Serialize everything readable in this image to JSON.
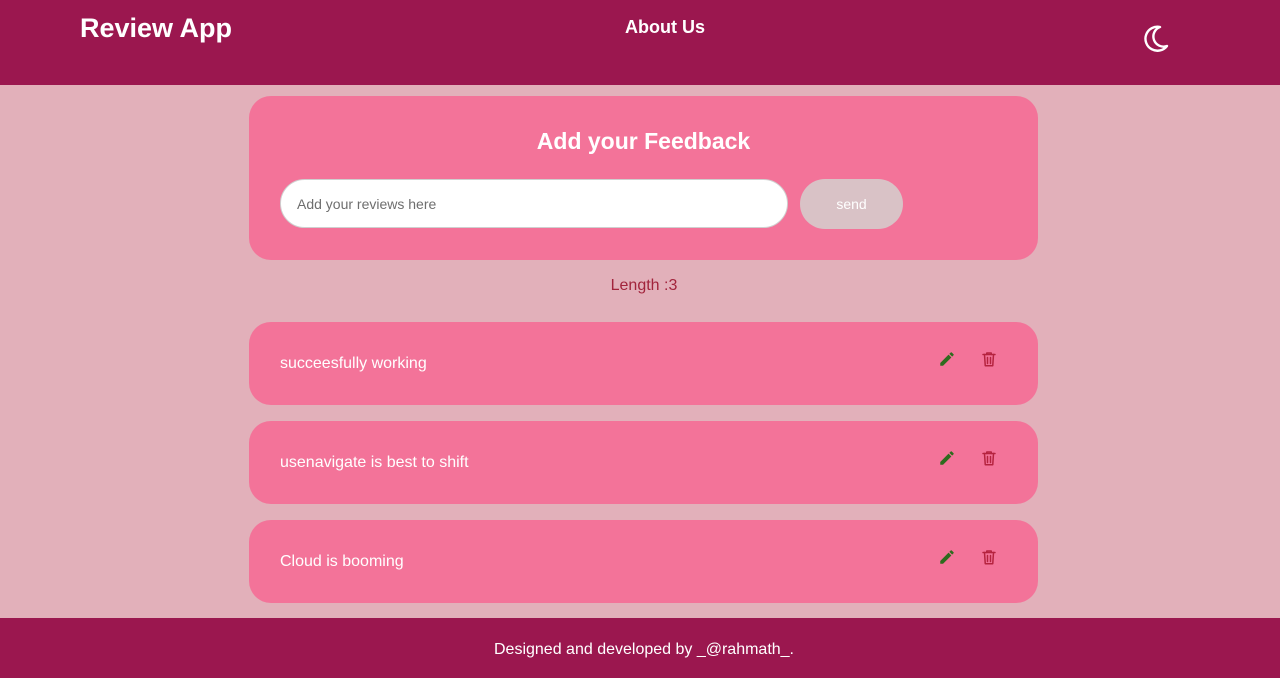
{
  "header": {
    "brand": "Review App",
    "nav_about": "About Us",
    "theme_icon": "moon-icon"
  },
  "form": {
    "title": "Add your Feedback",
    "input_placeholder": "Add your reviews here",
    "input_value": "",
    "send_label": "send"
  },
  "length_label": "Length :3",
  "reviews": [
    {
      "text": "succeesfully working",
      "edit_icon": "pencil-icon",
      "delete_icon": "trash-icon"
    },
    {
      "text": "usenavigate is best to shift",
      "edit_icon": "pencil-icon",
      "delete_icon": "trash-icon"
    },
    {
      "text": "Cloud is booming",
      "edit_icon": "pencil-icon",
      "delete_icon": "trash-icon"
    }
  ],
  "footer": {
    "text": "Designed and developed by _@rahmath_."
  },
  "colors": {
    "header_bg": "#9b174f",
    "page_bg": "#e2b0ba",
    "card_bg": "#f37399",
    "send_btn_bg": "#d9c2c6",
    "length_text": "#a2243c",
    "edit_icon": "#2e6b1e",
    "delete_icon": "#b5233f"
  }
}
